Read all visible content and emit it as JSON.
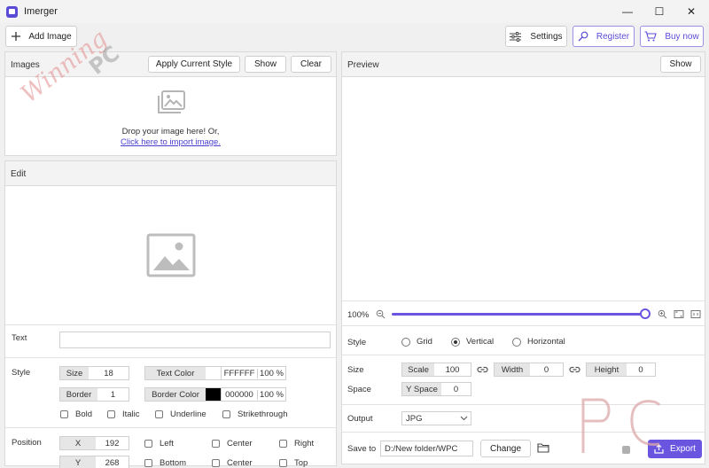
{
  "window": {
    "title": "Imerger",
    "controls": {
      "minimize": "—",
      "maximize": "☐",
      "close": "✕"
    }
  },
  "toolbar": {
    "add_image": "Add Image",
    "settings": "Settings",
    "register": "Register",
    "buy_now": "Buy now"
  },
  "images_panel": {
    "title": "Images",
    "apply_style": "Apply Current Style",
    "show": "Show",
    "clear": "Clear",
    "drop_text": "Drop your image here! Or,",
    "import_link": "Click here to import image."
  },
  "edit_panel": {
    "title": "Edit",
    "text_label": "Text",
    "text_value": "",
    "style_label": "Style",
    "size_label": "Size",
    "size_value": "18",
    "text_color_label": "Text Color",
    "text_color_hex": "FFFFFF",
    "text_color_opacity": "100 %",
    "text_color_swatch": "#ffffff",
    "border_label": "Border",
    "border_value": "1",
    "border_color_label": "Border Color",
    "border_color_hex": "000000",
    "border_color_opacity": "100 %",
    "border_color_swatch": "#000000",
    "bold": "Bold",
    "italic": "Italic",
    "underline": "Underline",
    "strikethrough": "Strikethrough",
    "position_label": "Position",
    "x_label": "X",
    "x_value": "192",
    "y_label": "Y",
    "y_value": "268",
    "left": "Left",
    "center1": "Center",
    "right": "Right",
    "bottom": "Bottom",
    "center2": "Center",
    "top": "Top"
  },
  "preview_panel": {
    "title": "Preview",
    "show": "Show",
    "zoom": "100%",
    "zoom_fraction": 1.0,
    "style_label": "Style",
    "style_options": [
      "Grid",
      "Vertical",
      "Horizontal"
    ],
    "style_selected": "Vertical",
    "size_label": "Size",
    "scale_label": "Scale",
    "scale_value": "100",
    "width_label": "Width",
    "width_value": "0",
    "height_label": "Height",
    "height_value": "0",
    "space_label": "Space",
    "yspace_label": "Y Space",
    "yspace_value": "0",
    "output_label": "Output",
    "output_format": "JPG",
    "save_to_label": "Save to",
    "save_path": "D:/New folder/WPC",
    "change": "Change",
    "export": "Export"
  },
  "watermarks": {
    "winning": "Winning",
    "pc": "PC"
  },
  "colors": {
    "accent": "#6a55e0",
    "link": "#4a3fd0"
  }
}
